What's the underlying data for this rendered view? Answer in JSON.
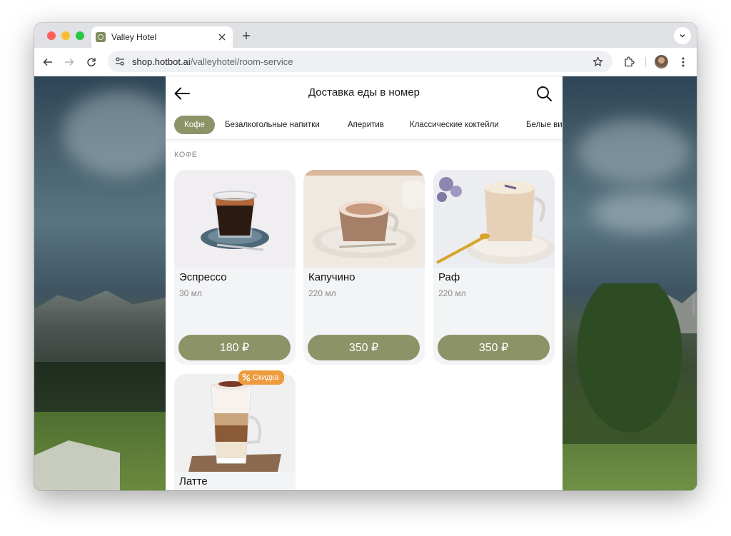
{
  "browser": {
    "tab_title": "Valley Hotel",
    "url_host": "shop.hotbot.ai",
    "url_path": "/valleyhotel/room-service",
    "icons": [
      "favicon-hotel",
      "close-icon",
      "plus-icon",
      "chevron-down-icon",
      "back-arrow-icon",
      "forward-arrow-icon",
      "reload-icon",
      "site-settings-icon",
      "star-icon",
      "extensions-icon",
      "profile-avatar",
      "kebab-menu-icon"
    ]
  },
  "app": {
    "title": "Доставка еды в номер",
    "categories": [
      {
        "label": "Кофе",
        "active": true
      },
      {
        "label": "Безалкогольные напитки",
        "active": false
      },
      {
        "label": "Аперитив",
        "active": false
      },
      {
        "label": "Классические коктейли",
        "active": false
      },
      {
        "label": "Белые ви",
        "active": false
      }
    ],
    "section_title": "КОФЕ",
    "products": [
      {
        "name": "Эспрессо",
        "volume": "30 мл",
        "price": "180 ₽"
      },
      {
        "name": "Капучино",
        "volume": "220 мл",
        "price": "350 ₽"
      },
      {
        "name": "Раф",
        "volume": "220 мл",
        "price": "350 ₽"
      },
      {
        "name": "Латте",
        "volume": "",
        "price": "",
        "badge": "Скидка"
      }
    ],
    "colors": {
      "accent": "#8c9367",
      "badge": "#ee9b3e"
    }
  }
}
